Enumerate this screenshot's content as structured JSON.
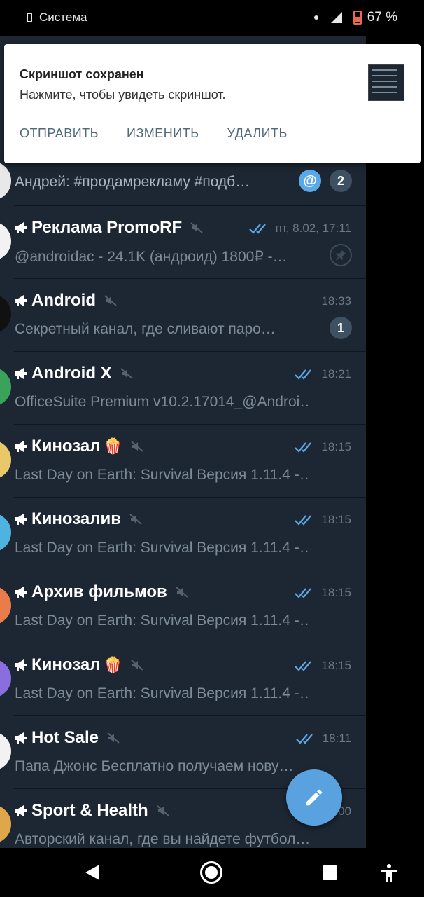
{
  "status_bar": {
    "app_label": "Система",
    "battery": "67 %"
  },
  "notification": {
    "title": "Скриншот сохранен",
    "text": "Нажмите, чтобы увидеть скриншот.",
    "actions": [
      "ОТПРАВИТЬ",
      "ИЗМЕНИТЬ",
      "УДАЛИТЬ"
    ]
  },
  "chats": [
    {
      "preview": "Андрей: #продамрекламу #подб…",
      "mention": "@",
      "unread": "2"
    },
    {
      "title": "Реклама PromoRF",
      "time": "пт, 8.02, 17:11",
      "preview": "@androidac - 24.1K (андроид) 1800₽ -…",
      "pinned": true,
      "read": true
    },
    {
      "title": "Android",
      "time": "18:33",
      "preview": "Секретный канал, где сливают паро…",
      "unread": "1",
      "read": false
    },
    {
      "title": "Android X",
      "time": "18:21",
      "preview": "OfficeSuite Premium v10.2.17014_@Androi…",
      "read": true
    },
    {
      "title": "Кинозал",
      "emoji": "🍿",
      "time": "18:15",
      "preview": "Last Day on Earth: Survival Версия 1.11.4 -…",
      "read": true
    },
    {
      "title": "Кинозалив",
      "time": "18:15",
      "preview": "Last Day on Earth: Survival Версия 1.11.4 -…",
      "read": true
    },
    {
      "title": "Архив фильмов",
      "time": "18:15",
      "preview": "Last Day on Earth: Survival Версия 1.11.4 -…",
      "read": true
    },
    {
      "title": "Кинозал ",
      "emoji": "🍿",
      "time": "18:15",
      "preview": "Last Day on Earth: Survival Версия 1.11.4 -…",
      "read": true
    },
    {
      "title": "Hot Sale",
      "time": "18:11",
      "preview": "Папа Джонс Бесплатно получаем нову…",
      "read": true
    },
    {
      "title": "Sport & Health",
      "time": "8:00",
      "preview": "Авторский канал, где вы найдете футбол…",
      "read": false
    }
  ],
  "colors": {
    "chat_bg": "#1d2733",
    "accent": "#5aa2df",
    "badge": "#3e5163",
    "preview_text": "#7d8b99"
  },
  "icons": [
    "megaphone-icon",
    "mute-icon",
    "double-check-icon",
    "pin-icon",
    "pencil-icon",
    "back-icon",
    "home-icon",
    "recents-icon",
    "accessibility-icon"
  ]
}
